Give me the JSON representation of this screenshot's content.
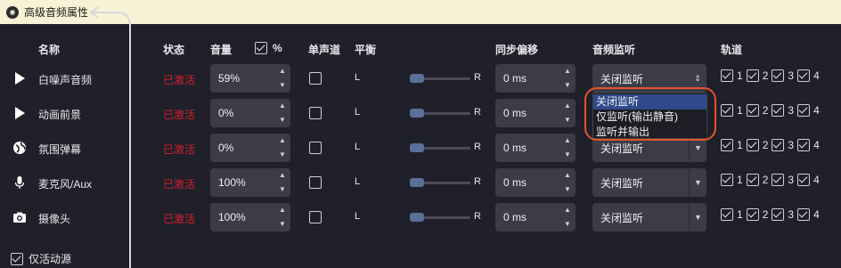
{
  "window": {
    "title": "高级音频属性"
  },
  "headers": {
    "name": "名称",
    "status": "状态",
    "volume": "音量",
    "percent": "%",
    "mono": "单声道",
    "balance": "平衡",
    "sync_offset": "同步偏移",
    "monitoring": "音频监听",
    "tracks": "轨道"
  },
  "balance_labels": {
    "left": "L",
    "right": "R"
  },
  "rows": [
    {
      "name": "白噪声音频",
      "icon": "play-icon",
      "status": "已激活",
      "volume": "59%",
      "mono": false,
      "offset": "0 ms",
      "monitoring": "关闭监听"
    },
    {
      "name": "动画前景",
      "icon": "play-icon",
      "status": "已激活",
      "volume": "0%",
      "mono": false,
      "offset": "0 ms",
      "monitoring": "关闭监听"
    },
    {
      "name": "氛围弹幕",
      "icon": "globe-icon",
      "status": "已激活",
      "volume": "0%",
      "mono": false,
      "offset": "0 ms",
      "monitoring": "关闭监听"
    },
    {
      "name": "麦克风/Aux",
      "icon": "microphone-icon",
      "status": "已激活",
      "volume": "100%",
      "mono": false,
      "offset": "0 ms",
      "monitoring": "关闭监听"
    },
    {
      "name": "摄像头",
      "icon": "camera-icon",
      "status": "已激活",
      "volume": "100%",
      "mono": false,
      "offset": "0 ms",
      "monitoring": "关闭监听"
    }
  ],
  "track_labels": [
    "1",
    "2",
    "3",
    "4"
  ],
  "dropdown_options": [
    "关闭监听",
    "仅监听(输出静音)",
    "监听并输出"
  ],
  "dropdown_selected": "关闭监听",
  "footer": {
    "active_only_label": "仅活动源",
    "active_only_checked": true
  },
  "colors": {
    "status_active": "#d1202f",
    "annotation_ring": "#e5542a",
    "title_bg": "#f7f2d6"
  }
}
